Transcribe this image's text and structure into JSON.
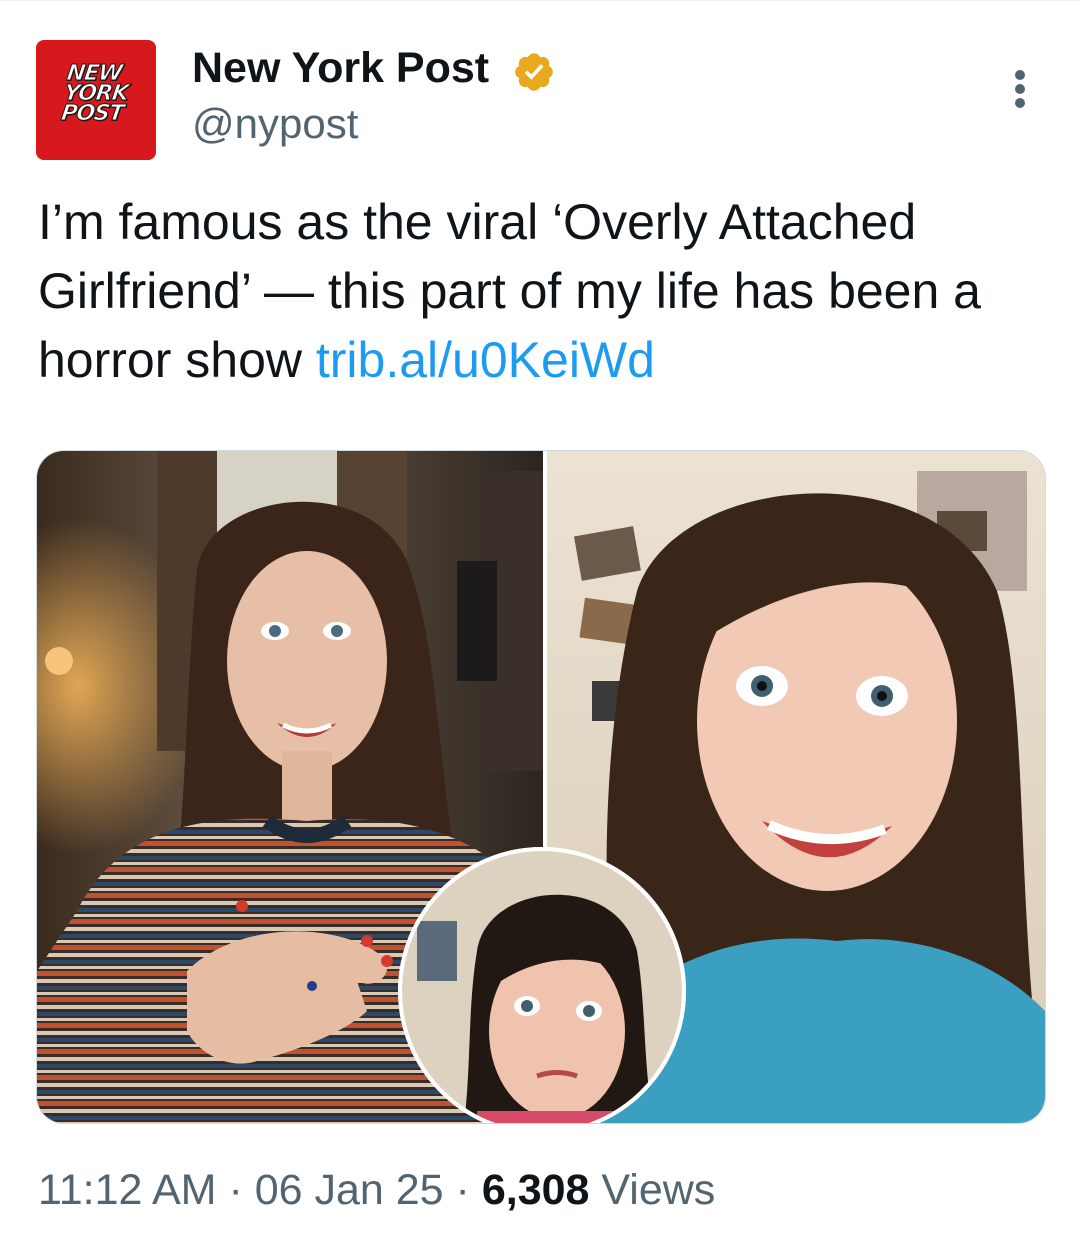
{
  "author": {
    "avatar_text": "NEW\nYORK\nPOST",
    "display_name": "New York Post",
    "handle": "@nypost",
    "verified_badge_color": "#e8a91e",
    "avatar_color": "#d7191e"
  },
  "tweet": {
    "text": "I’m famous as the viral ‘Overly Attached Girlfriend’ — this part of my life has been a horror show ",
    "link_text": "trib.al/u0KeiWd",
    "link_color": "#1d9bf0"
  },
  "footer": {
    "time": "11:12 AM",
    "separator": " · ",
    "date": "06 Jan 25",
    "views_count": "6,308",
    "views_label": " Views"
  },
  "icons": {
    "more": "more-vertical-icon",
    "verified": "verified-badge-icon"
  }
}
